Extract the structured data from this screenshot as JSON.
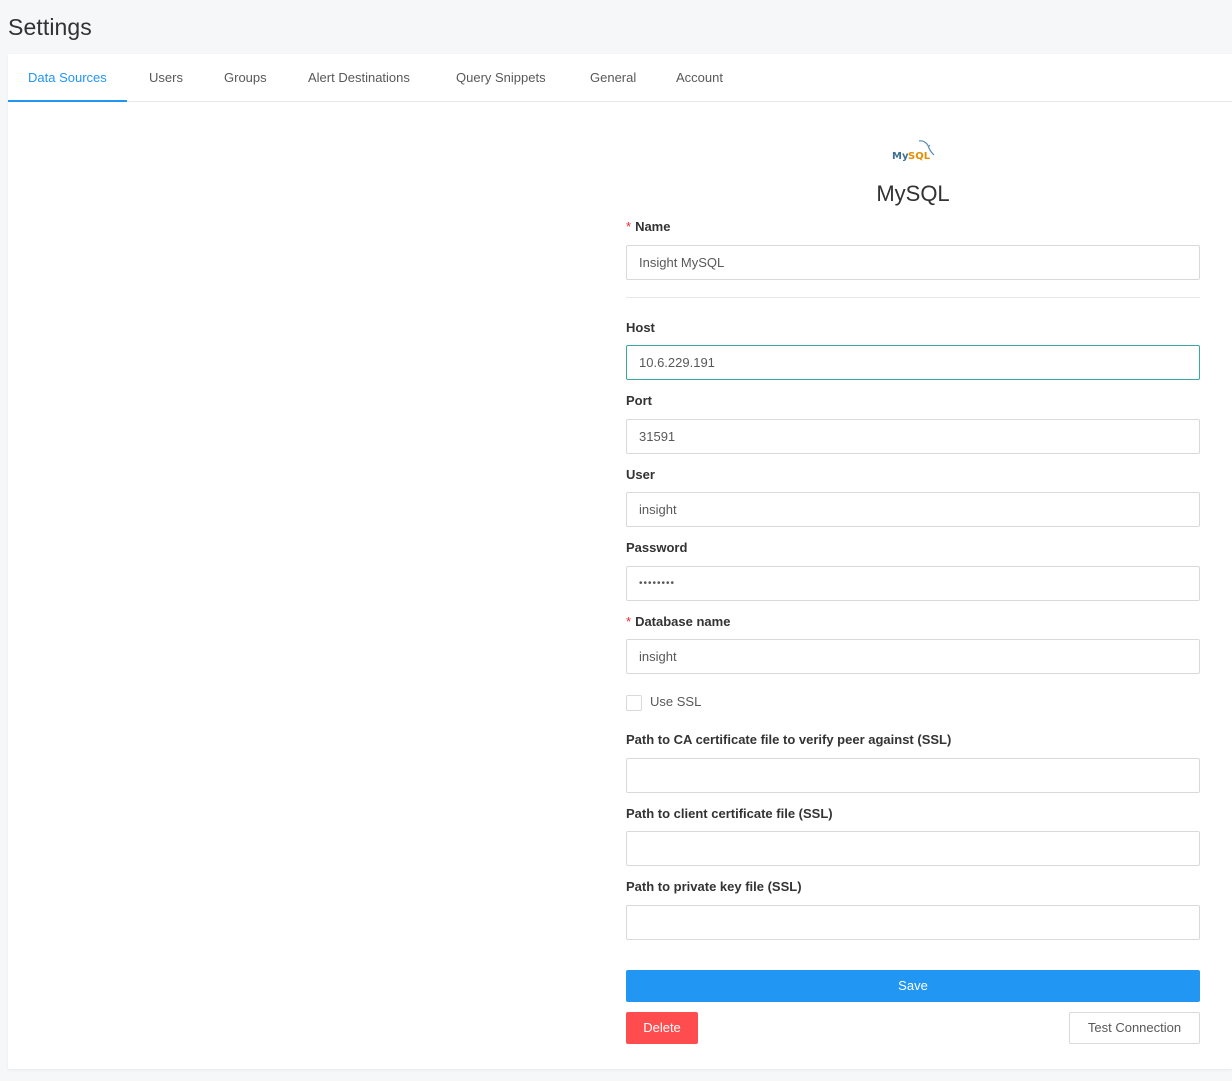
{
  "page": {
    "title": "Settings"
  },
  "tabs": [
    {
      "label": "Data Sources",
      "active": true
    },
    {
      "label": "Users"
    },
    {
      "label": "Groups"
    },
    {
      "label": "Alert Destinations"
    },
    {
      "label": "Query Snippets"
    },
    {
      "label": "General"
    },
    {
      "label": "Account"
    }
  ],
  "datasource": {
    "logo_text": "MySQL",
    "title": "MySQL"
  },
  "form": {
    "required_mark": "*",
    "name": {
      "label": "Name",
      "value": "Insight MySQL"
    },
    "host": {
      "label": "Host",
      "value": "10.6.229.191"
    },
    "port": {
      "label": "Port",
      "value": "31591"
    },
    "user": {
      "label": "User",
      "value": "insight"
    },
    "password": {
      "label": "Password",
      "value": "••••••••"
    },
    "dbname": {
      "label": "Database name",
      "value": "insight"
    },
    "use_ssl": {
      "label": "Use SSL",
      "checked": false
    },
    "ssl_ca": {
      "label": "Path to CA certificate file to verify peer against (SSL)",
      "value": ""
    },
    "ssl_cert": {
      "label": "Path to client certificate file (SSL)",
      "value": ""
    },
    "ssl_key": {
      "label": "Path to private key file (SSL)",
      "value": ""
    }
  },
  "buttons": {
    "save": "Save",
    "delete": "Delete",
    "test": "Test Connection"
  },
  "colors": {
    "accent": "#2196f3",
    "danger": "#ff4d4f",
    "focus_border": "#3aa8a0"
  }
}
